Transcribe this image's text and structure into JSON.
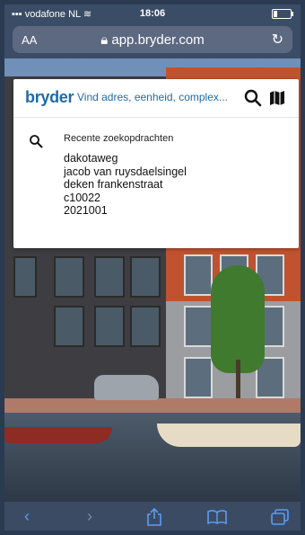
{
  "status": {
    "carrier": "vodafone NL",
    "time": "18:06"
  },
  "browser": {
    "text_size_label": "AA",
    "url": "app.bryder.com"
  },
  "search": {
    "logo": "bryder",
    "placeholder": "Vind adres, eenheid, complex...",
    "recent_title": "Recente zoekopdrachten",
    "recent_items": [
      "dakotaweg",
      "jacob van ruysdaelsingel",
      "deken frankenstraat",
      "c10022",
      "2021001"
    ]
  },
  "colors": {
    "brand": "#1e6ba8",
    "ios_blue": "#5b9cf0"
  },
  "icons": {
    "signal": "signal-bars-icon",
    "wifi": "wifi-icon",
    "battery": "battery-icon",
    "lock": "lock-icon",
    "reload": "reload-icon",
    "search": "search-icon",
    "map": "map-icon",
    "back": "back-icon",
    "forward": "forward-icon",
    "share": "share-icon",
    "bookmarks": "bookmarks-icon",
    "tabs": "tabs-icon"
  }
}
